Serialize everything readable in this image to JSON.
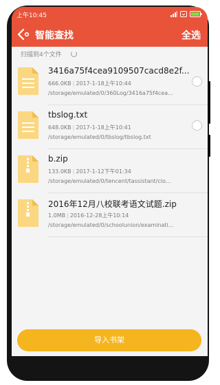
{
  "status_bar": {
    "time": "上午10:45",
    "icons": [
      "signal-icon",
      "wifi-icon",
      "battery-icon"
    ]
  },
  "header": {
    "title": "智能查找",
    "select_all": "全选",
    "color": "#e8533a"
  },
  "scan": {
    "text": "扫描到4个文件"
  },
  "files": [
    {
      "name": "3416a75f4cea9109507cacd8e2f...",
      "size": "666.0KB",
      "date": "2017-1-18上午10:44",
      "path": "/storage/emulated/0/360Log/3416a75f4cea...",
      "type": "doc-icon",
      "checkable": true
    },
    {
      "name": "tbslog.txt",
      "size": "648.0KB",
      "date": "2017-1-18上午10:41",
      "path": "/storage/emulated/0/tbslog/tbslog.txt",
      "type": "doc-icon",
      "checkable": true
    },
    {
      "name": "b.zip",
      "size": "133.0KB",
      "date": "2017-1-12下午01:34",
      "path": "/storage/emulated/0/tencent/tassistant/clo...",
      "type": "zip-icon",
      "checkable": false
    },
    {
      "name": "2016年12月八校联考语文试题.zip",
      "size": "1.0MB",
      "date": "2016-12-28上午10:14",
      "path": "/storage/emulated/0/schoolunion/examinati...",
      "type": "zip-icon",
      "checkable": false
    }
  ],
  "import_button": {
    "label": "导入书架",
    "color": "#f5b51f"
  }
}
